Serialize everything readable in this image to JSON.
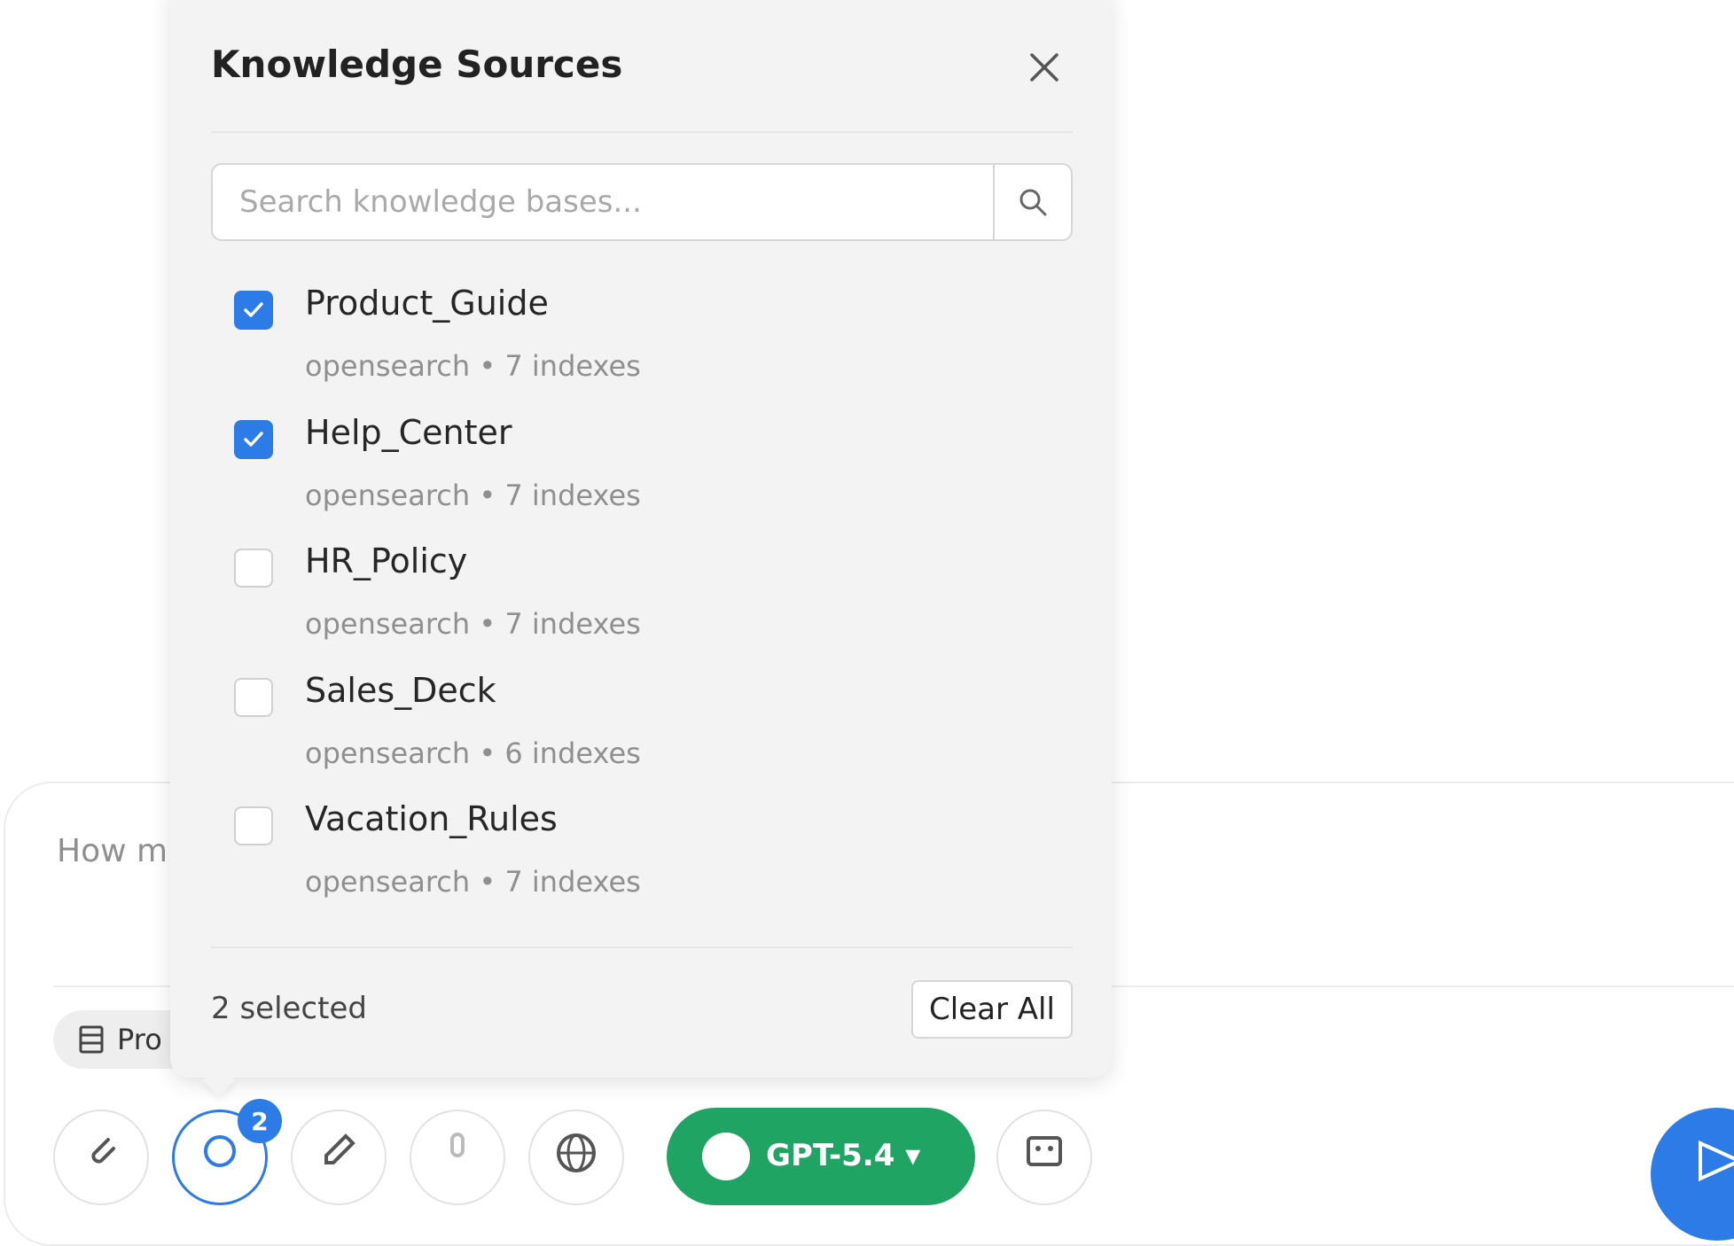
{
  "composer": {
    "input_text": "How m",
    "chip_label": "Pro",
    "chip_icon": "list-icon"
  },
  "toolbar": {
    "knowledge_badge": "2",
    "model_label": "GPT-5.4 ▾",
    "icons": [
      "paperclip-icon",
      "search-icon",
      "edit-icon",
      "mic-icon",
      "globe-icon",
      "bot-icon",
      "send-icon"
    ]
  },
  "popover": {
    "title": "Knowledge Sources",
    "search_placeholder": "Search knowledge bases...",
    "items": [
      {
        "name": "Product_Guide",
        "meta": "opensearch • 7 indexes",
        "checked": true
      },
      {
        "name": "Help_Center",
        "meta": "opensearch • 7 indexes",
        "checked": true
      },
      {
        "name": "HR_Policy",
        "meta": "opensearch • 7 indexes",
        "checked": false
      },
      {
        "name": "Sales_Deck",
        "meta": "opensearch • 6 indexes",
        "checked": false
      },
      {
        "name": "Vacation_Rules",
        "meta": "opensearch • 7 indexes",
        "checked": false
      }
    ],
    "selected_count": "2 selected",
    "clear_label": "Clear All"
  },
  "colors": {
    "accent": "#2d7be6",
    "model_green": "#20a464",
    "popover_bg": "#f3f3f3"
  }
}
